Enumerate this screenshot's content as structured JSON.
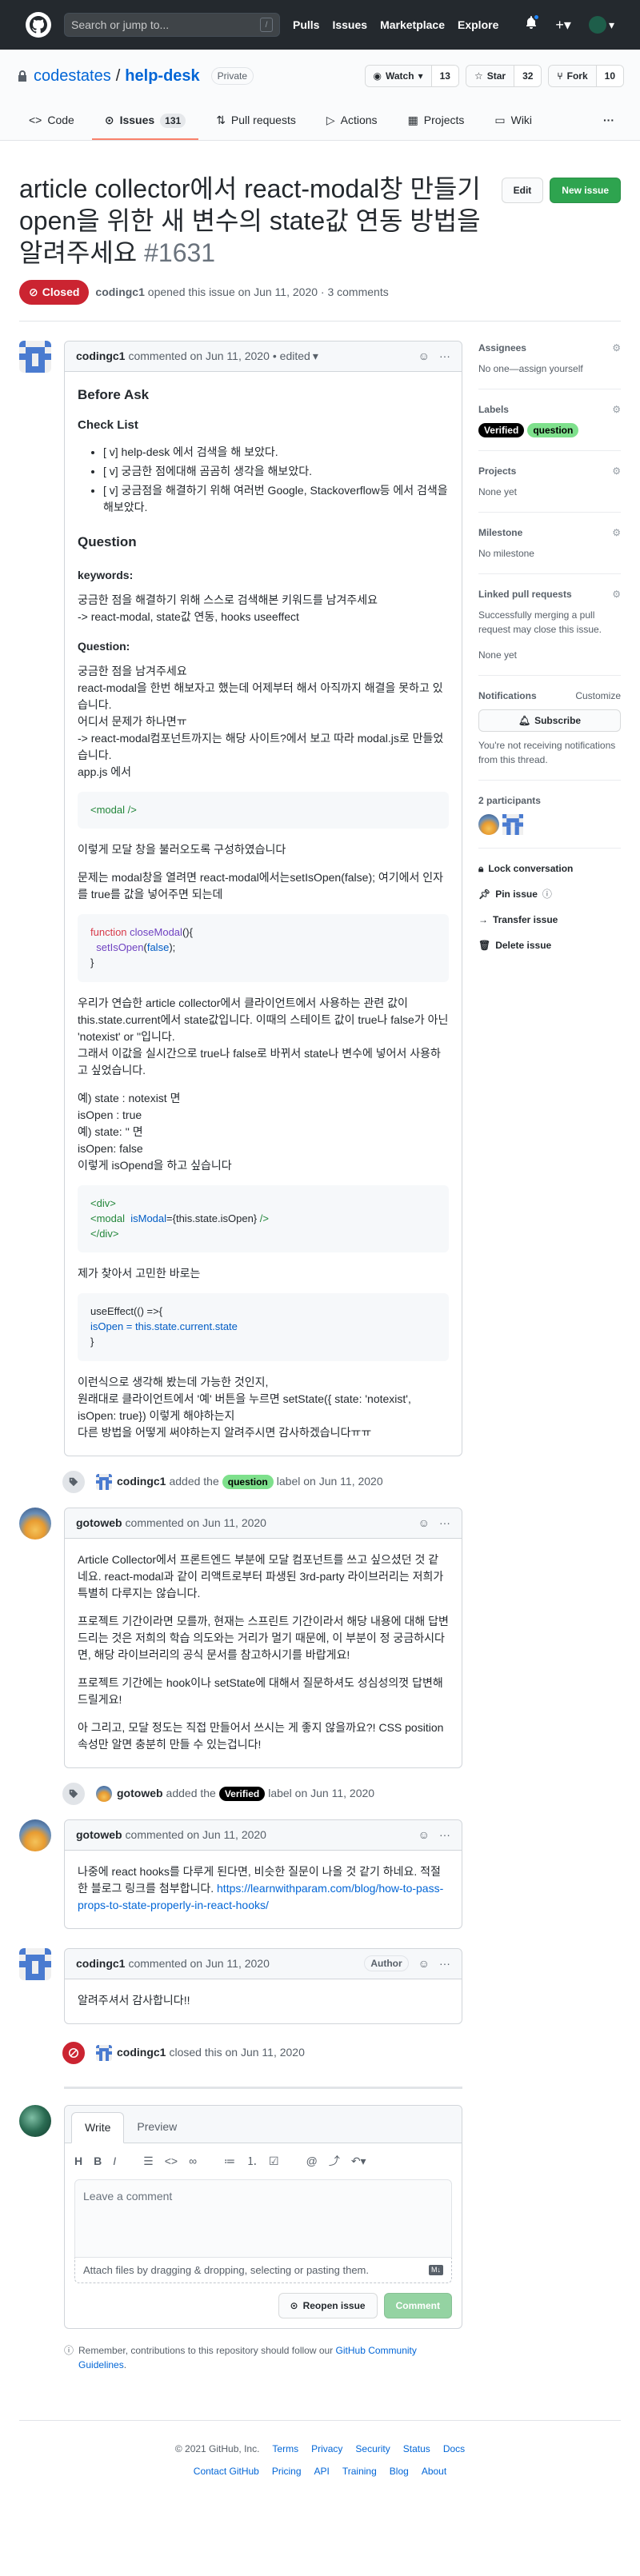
{
  "header": {
    "search_placeholder": "Search or jump to...",
    "slash_key": "/",
    "nav": [
      "Pulls",
      "Issues",
      "Marketplace",
      "Explore"
    ]
  },
  "repo": {
    "owner": "codestates",
    "separator": "/",
    "name": "help-desk",
    "visibility": "Private",
    "watch_label": "Watch",
    "watch_count": "13",
    "star_label": "Star",
    "star_count": "32",
    "fork_label": "Fork",
    "fork_count": "10",
    "tabs": [
      {
        "label": "Code",
        "icon": "code-icon"
      },
      {
        "label": "Issues",
        "icon": "issue-icon",
        "count": "131",
        "active": true
      },
      {
        "label": "Pull requests",
        "icon": "pull-request-icon"
      },
      {
        "label": "Actions",
        "icon": "play-icon"
      },
      {
        "label": "Projects",
        "icon": "project-icon"
      },
      {
        "label": "Wiki",
        "icon": "book-icon"
      }
    ],
    "more": "···"
  },
  "issue": {
    "title": "article collector에서 react-modal창 만들기 open을 위한 새 변수의 state값 연동 방법을 알려주세요",
    "number": "#1631",
    "edit_label": "Edit",
    "new_issue_label": "New issue",
    "state": "Closed",
    "author": "codingc1",
    "opened_text": "opened this issue on Jun 11, 2020 · 3 comments"
  },
  "first_comment": {
    "author": "codingc1",
    "commented": "commented on Jun 11, 2020",
    "edited": "• edited",
    "before_ask": "Before Ask",
    "check_list": "Check List",
    "checks": [
      "[ v] help-desk 에서 검색을 해 보았다.",
      "[ v] 궁금한 점에대해 곰곰히 생각을 해보았다.",
      "[ v] 궁금점을 해결하기 위해 여러번 Google, Stackoverflow등 에서 검색을 해보았다."
    ],
    "question_h": "Question",
    "keywords_h": "keywords:",
    "keywords_p1": "궁금한 점을 해결하기 위해 스스로 검색해본 키워드를 남겨주세요",
    "keywords_p2": "-> react-modal, state값 연동, hooks useeffect",
    "question_sub": "Question:",
    "q_lines": [
      "궁금한 점을 남겨주세요",
      "react-modal을 한번 해보자고 했는데 어제부터 해서 아직까지 해결을 못하고 있습니다.",
      "어디서 문제가 하나면ㅠ",
      "-> react-modal컴포넌트까지는 해당 사이트?에서 보고 따라 modal.js로 만들었습니다.",
      "app.js 에서"
    ],
    "code1": "<modal />",
    "p_modal": "이렇게 모달 창을 불러오도록 구성하였습니다",
    "p_problem": "문제는 modal창을 열려면 react-modal에서는setIsOpen(false); 여기에서 인자를 true를 값을 넣어주면 되는데",
    "code2_fn": "function",
    "code2_name": "closeModal",
    "code2_line1_end": "(){",
    "code2_line2_call": "setIsOpen",
    "code2_line2_arg": "false",
    "code2_line3": "}",
    "p_collector": [
      "우리가 연습한 article collector에서 클라이언트에서 사용하는 관련 값이 this.state.current에서 state값입니다. 이때의 스테이트 값이 true나 false가 아닌 'notexist' or ''입니다.",
      "그래서 이값을 실시간으로 true나 false로 바뀌서 state나 변수에 넣어서 사용하고 싶었습니다."
    ],
    "ex_lines": [
      "예) state : notexist 면",
      "isOpen : true",
      "예) state: '' 면",
      "isOpen: false",
      "이렇게 isOpend을 하고 싶습니다"
    ],
    "code3_l1": "<div>",
    "code3_l2_tag": "<modal",
    "code3_l2_attr": "isModal",
    "code3_l2_val": "{this.state.isOpen}",
    "code3_l2_end": "/>",
    "code3_l3": "</div>",
    "p_found": "제가 찾아서 고민한 바로는",
    "code4_l1": "useEffect(() =>{",
    "code4_l2": "isOpen = this.state.current.state",
    "code4_l3": "}",
    "closing_lines": [
      "이런식으로 생각해 봤는데 가능한 것인지,",
      "원래대로 클라이언트에서 '예' 버튼을 누르면 setState({ state: 'notexist', isOpen: true}) 이렇게 해야하는지",
      "다른 방법을 어떻게 써야하는지 알려주시면 감사하겠습니다ㅠㅠ"
    ]
  },
  "event_label_question": {
    "actor": "codingc1",
    "text1": "added the",
    "label": "question",
    "text2": "label on Jun 11, 2020"
  },
  "comment_gotoweb_1": {
    "author": "gotoweb",
    "commented": "commented on Jun 11, 2020",
    "paras": [
      "Article Collector에서 프론트엔드 부분에 모달 컴포넌트를 쓰고 싶으셨던 것 같네요. react-modal과 같이 리액트로부터 파생된 3rd-party 라이브러리는 저희가 특별히 다루지는 않습니다.",
      "프로젝트 기간이라면 모를까, 현재는 스프린트 기간이라서 해당 내용에 대해 답변 드리는 것은 저희의 학습 의도와는 거리가 멀기 때문에, 이 부분이 정 궁금하시다면, 해당 라이브러리의 공식 문서를 참고하시기를 바랍게요!",
      "프로젝트 기간에는 hook이나 setState에 대해서 질문하셔도 성심성의껏 답변해드릴게요!",
      "아 그리고, 모달 정도는 직접 만들어서 쓰시는 게 좋지 않을까요?! CSS position 속성만 알면 충분히 만들 수 있는겁니다!"
    ]
  },
  "event_label_verified": {
    "actor": "gotoweb",
    "text1": "added the",
    "label": "Verified",
    "text2": "label on Jun 11, 2020"
  },
  "comment_gotoweb_2": {
    "author": "gotoweb",
    "commented": "commented on Jun 11, 2020",
    "text": "나중에 react hooks를 다루게 된다면, 비슷한 질문이 나올 것 같기 하네요. 적절한 블로그 링크를 첨부합니다.",
    "link": "https://learnwithparam.com/blog/how-to-pass-props-to-state-properly-in-react-hooks/"
  },
  "comment_codingc1_2": {
    "author": "codingc1",
    "commented": "commented on Jun 11, 2020",
    "badge": "Author",
    "text": "알려주셔서 감사합니다!!"
  },
  "event_closed": {
    "actor": "codingc1",
    "text": "closed this on Jun 11, 2020"
  },
  "editor": {
    "tab_write": "Write",
    "tab_preview": "Preview",
    "placeholder": "Leave a comment",
    "attach_text": "Attach files by dragging & dropping, selecting or pasting them.",
    "reopen_label": "Reopen issue",
    "comment_label": "Comment",
    "remember_text": "Remember, contributions to this repository should follow our",
    "remember_link": "GitHub Community Guidelines",
    "remember_end": "."
  },
  "sidebar": {
    "assignees_title": "Assignees",
    "assignees_text": "No one—assign yourself",
    "labels_title": "Labels",
    "labels": [
      {
        "name": "Verified",
        "color": "#000000"
      },
      {
        "name": "question",
        "color": "#7ee08c"
      }
    ],
    "projects_title": "Projects",
    "projects_text": "None yet",
    "milestone_title": "Milestone",
    "milestone_text": "No milestone",
    "linked_title": "Linked pull requests",
    "linked_text": "Successfully merging a pull request may close this issue.",
    "linked_none": "None yet",
    "notifications_title": "Notifications",
    "customize": "Customize",
    "subscribe": "Subscribe",
    "notif_text": "You're not receiving notifications from this thread.",
    "participants": "2 participants",
    "lock": "Lock conversation",
    "pin": "Pin issue",
    "transfer": "Transfer issue",
    "delete": "Delete issue"
  },
  "footer": {
    "copyright": "© 2021 GitHub, Inc.",
    "row1": [
      "Terms",
      "Privacy",
      "Security",
      "Status",
      "Docs"
    ],
    "row2": [
      "Contact GitHub",
      "Pricing",
      "API",
      "Training",
      "Blog",
      "About"
    ]
  },
  "colors": {
    "header_bg": "#24292e",
    "closed_red": "#cb2431",
    "green_button": "#2ea44f",
    "link_blue": "#0366d6",
    "tab_underline": "#f9826c"
  }
}
